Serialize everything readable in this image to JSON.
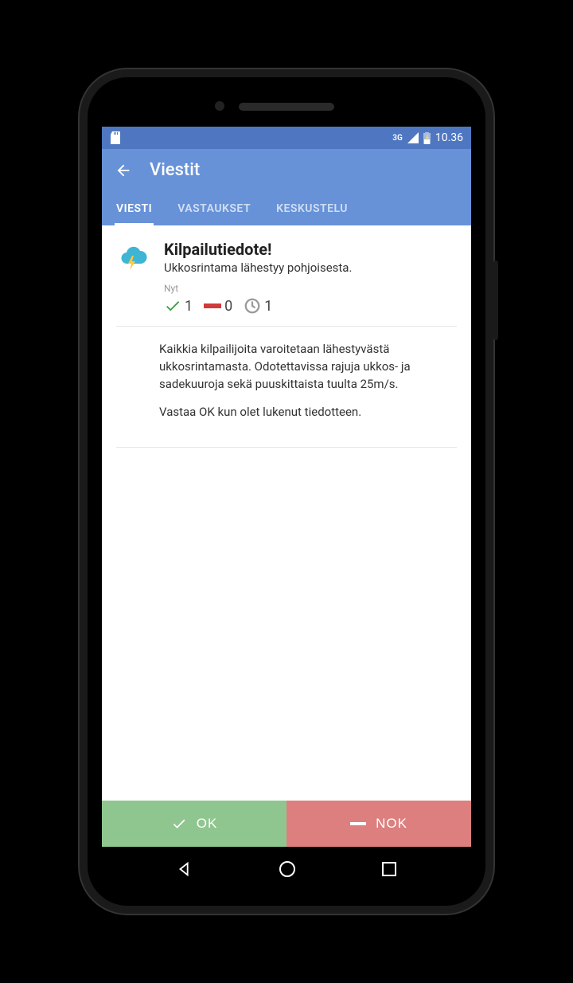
{
  "statusbar": {
    "network_label": "3G",
    "time": "10.36"
  },
  "appbar": {
    "title": "Viestit"
  },
  "tabs": {
    "message": "VIESTI",
    "answers": "VASTAUKSET",
    "discussion": "KESKUSTELU"
  },
  "message": {
    "title": "Kilpailutiedote!",
    "subtitle": "Ukkosrintama lähestyy pohjoisesta.",
    "now_label": "Nyt",
    "counts": {
      "ok": "1",
      "nok": "0",
      "pending": "1"
    },
    "body_p1": "Kaikkia kilpailijoita varoitetaan lähestyvästä ukkosrintamasta. Odotettavissa rajuja ukkos- ja sadekuuroja sekä puuskittaista tuulta 25m/s.",
    "body_p2": "Vastaa OK kun olet lukenut tiedotteen."
  },
  "actions": {
    "ok": "OK",
    "nok": "NOK"
  }
}
